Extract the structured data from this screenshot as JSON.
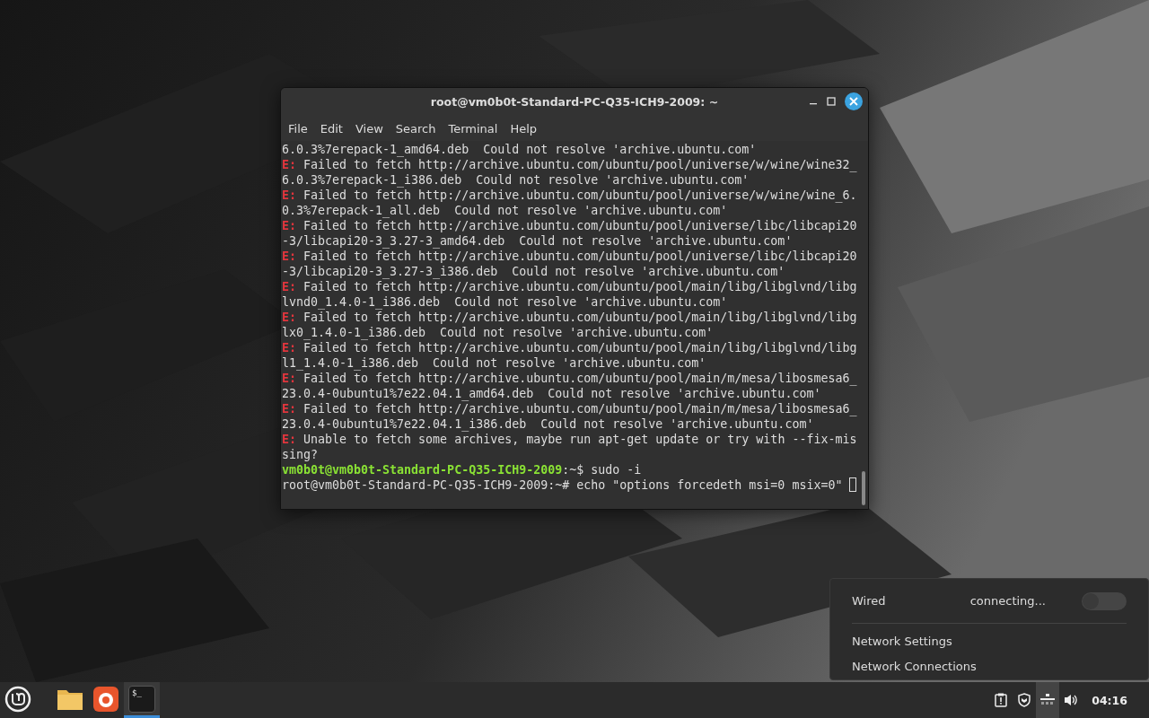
{
  "terminal": {
    "title": "root@vm0b0t-Standard-PC-Q35-ICH9-2009: ~",
    "menu": [
      "File",
      "Edit",
      "View",
      "Search",
      "Terminal",
      "Help"
    ],
    "lines": [
      {
        "kind": "plain",
        "text": "6.0.3%7erepack-1_amd64.deb  Could not resolve 'archive.ubuntu.com'"
      },
      {
        "kind": "error",
        "prefix": "E:",
        "text": " Failed to fetch http://archive.ubuntu.com/ubuntu/pool/universe/w/wine/wine32_"
      },
      {
        "kind": "plain",
        "text": "6.0.3%7erepack-1_i386.deb  Could not resolve 'archive.ubuntu.com'"
      },
      {
        "kind": "error",
        "prefix": "E:",
        "text": " Failed to fetch http://archive.ubuntu.com/ubuntu/pool/universe/w/wine/wine_6."
      },
      {
        "kind": "plain",
        "text": "0.3%7erepack-1_all.deb  Could not resolve 'archive.ubuntu.com'"
      },
      {
        "kind": "error",
        "prefix": "E:",
        "text": " Failed to fetch http://archive.ubuntu.com/ubuntu/pool/universe/libc/libcapi20"
      },
      {
        "kind": "plain",
        "text": "-3/libcapi20-3_3.27-3_amd64.deb  Could not resolve 'archive.ubuntu.com'"
      },
      {
        "kind": "error",
        "prefix": "E:",
        "text": " Failed to fetch http://archive.ubuntu.com/ubuntu/pool/universe/libc/libcapi20"
      },
      {
        "kind": "plain",
        "text": "-3/libcapi20-3_3.27-3_i386.deb  Could not resolve 'archive.ubuntu.com'"
      },
      {
        "kind": "error",
        "prefix": "E:",
        "text": " Failed to fetch http://archive.ubuntu.com/ubuntu/pool/main/libg/libglvnd/libg"
      },
      {
        "kind": "plain",
        "text": "lvnd0_1.4.0-1_i386.deb  Could not resolve 'archive.ubuntu.com'"
      },
      {
        "kind": "error",
        "prefix": "E:",
        "text": " Failed to fetch http://archive.ubuntu.com/ubuntu/pool/main/libg/libglvnd/libg"
      },
      {
        "kind": "plain",
        "text": "lx0_1.4.0-1_i386.deb  Could not resolve 'archive.ubuntu.com'"
      },
      {
        "kind": "error",
        "prefix": "E:",
        "text": " Failed to fetch http://archive.ubuntu.com/ubuntu/pool/main/libg/libglvnd/libg"
      },
      {
        "kind": "plain",
        "text": "l1_1.4.0-1_i386.deb  Could not resolve 'archive.ubuntu.com'"
      },
      {
        "kind": "error",
        "prefix": "E:",
        "text": " Failed to fetch http://archive.ubuntu.com/ubuntu/pool/main/m/mesa/libosmesa6_"
      },
      {
        "kind": "plain",
        "text": "23.0.4-0ubuntu1%7e22.04.1_amd64.deb  Could not resolve 'archive.ubuntu.com'"
      },
      {
        "kind": "error",
        "prefix": "E:",
        "text": " Failed to fetch http://archive.ubuntu.com/ubuntu/pool/main/m/mesa/libosmesa6_"
      },
      {
        "kind": "plain",
        "text": "23.0.4-0ubuntu1%7e22.04.1_i386.deb  Could not resolve 'archive.ubuntu.com'"
      },
      {
        "kind": "error",
        "prefix": "E:",
        "text": " Unable to fetch some archives, maybe run apt-get update or try with --fix-mis"
      },
      {
        "kind": "plain",
        "text": "sing?"
      },
      {
        "kind": "prompt",
        "prefix": "vm0b0t@vm0b0t-Standard-PC-Q35-ICH9-2009",
        "text": ":~$ sudo -i"
      },
      {
        "kind": "input",
        "text": "root@vm0b0t-Standard-PC-Q35-ICH9-2009:~# echo \"options forcedeth msi=0 msix=0\" "
      }
    ]
  },
  "network_popup": {
    "connection": "Wired",
    "status": "connecting...",
    "on": false,
    "items": [
      "Network Settings",
      "Network Connections"
    ]
  },
  "taskbar": {
    "launchers": [
      {
        "kind": "menu",
        "selected": false
      },
      {
        "kind": "files",
        "selected": false
      },
      {
        "kind": "browser",
        "selected": false
      },
      {
        "kind": "terminal",
        "glyph": "$_",
        "selected": true
      }
    ],
    "tray": [
      {
        "kind": "clipboard",
        "selected": false
      },
      {
        "kind": "shield",
        "selected": false
      },
      {
        "kind": "network",
        "selected": true
      },
      {
        "kind": "volume",
        "selected": false
      }
    ],
    "clock": "04:16"
  }
}
